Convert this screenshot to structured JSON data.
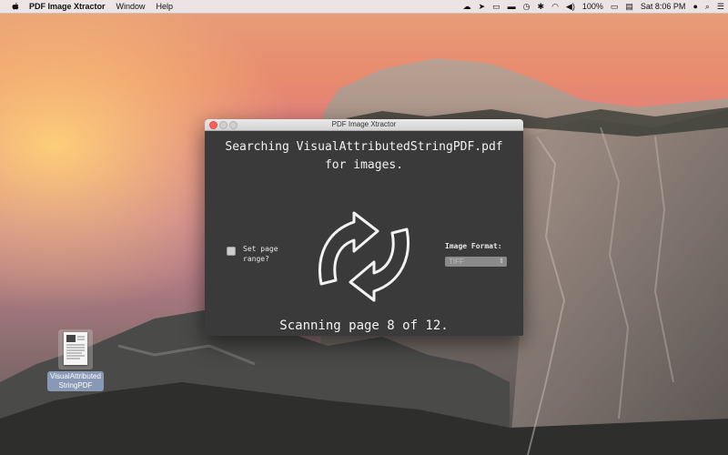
{
  "menubar": {
    "app_name": "PDF Image Xtractor",
    "menus": [
      "Window",
      "Help"
    ],
    "battery": "100%",
    "clock": "Sat 8:06 PM"
  },
  "window": {
    "title": "PDF Image Xtractor",
    "search_line1": "Searching VisualAttributedStringPDF.pdf",
    "search_line2": "for images.",
    "page_range_label": "Set page range?",
    "image_format_label": "Image Format:",
    "image_format_value": "TIFF",
    "scanning_status": "Scanning page 8 of 12."
  },
  "desktop": {
    "file_label_line1": "VisualAttributed",
    "file_label_line2": "StringPDF"
  }
}
